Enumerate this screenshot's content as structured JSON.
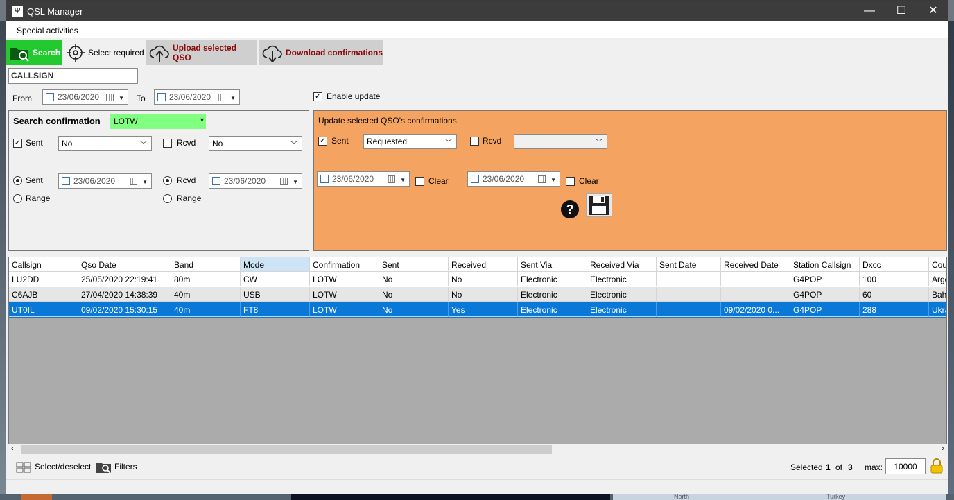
{
  "window": {
    "title": "QSL Manager",
    "minimize": "—",
    "maximize": "☐",
    "close": "✕"
  },
  "menu": {
    "special_activities": "Special activities"
  },
  "toolbar": {
    "search": "Search",
    "select_required": "Select required",
    "upload": "Upload selected QSO",
    "download": "Download confirmations"
  },
  "filters": {
    "callsign": "CALLSIGN",
    "from_label": "From",
    "from_date": "23/06/2020",
    "to_label": "To",
    "to_date": "23/06/2020",
    "enable_update_label": "Enable update",
    "enable_update_checked": true
  },
  "search_panel": {
    "title": "Search confirmation",
    "service": "LOTW",
    "sent_label": "Sent",
    "sent_value": "No",
    "rcvd_label": "Rcvd",
    "rcvd_value": "No",
    "radio_sent": "Sent",
    "radio_sent_date": "23/06/2020",
    "radio_range": "Range",
    "radio_rcvd": "Rcvd",
    "radio_rcvd_date": "23/06/2020",
    "radio_range2": "Range"
  },
  "update_panel": {
    "title": "Update selected QSO's confirmations",
    "sent_label": "Sent",
    "sent_value": "Requested",
    "rcvd_label": "Rcvd",
    "rcvd_value": "",
    "sent_date": "23/06/2020",
    "clear1": "Clear",
    "rcvd_date": "23/06/2020",
    "clear2": "Clear",
    "help": "?"
  },
  "grid": {
    "columns": [
      "Callsign",
      "Qso Date",
      "Band",
      "Mode",
      "Confirmation",
      "Sent",
      "Received",
      "Sent Via",
      "Received Via",
      "Sent Date",
      "Received Date",
      "Station Callsign",
      "Dxcc",
      "Cou"
    ],
    "rows": [
      [
        "LU2DD",
        "25/05/2020 22:19:41",
        "80m",
        "CW",
        "LOTW",
        "No",
        "No",
        "Electronic",
        "Electronic",
        "",
        "",
        "G4POP",
        "100",
        "Arge"
      ],
      [
        "C6AJB",
        "27/04/2020 14:38:39",
        "40m",
        "USB",
        "LOTW",
        "No",
        "No",
        "Electronic",
        "Electronic",
        "",
        "",
        "G4POP",
        "60",
        "Bah"
      ],
      [
        "UT0IL",
        "09/02/2020 15:30:15",
        "40m",
        "FT8",
        "LOTW",
        "No",
        "Yes",
        "Electronic",
        "Electronic",
        "",
        "09/02/2020 0...",
        "G4POP",
        "288",
        "Ukra"
      ]
    ],
    "selected_row": 2
  },
  "status": {
    "select_deselect": "Select/deselect",
    "filters": "Filters",
    "selected_label": "Selected",
    "selected_count": "1",
    "of_label": "of",
    "total": "3",
    "max_label": "max:",
    "max_value": "10000"
  },
  "desktop": {
    "north": "North",
    "turkey": "Turkey"
  },
  "colors": {
    "search_green": "#22c92f",
    "update_orange": "#f4a460",
    "selection_blue": "#0a78d7",
    "service_green": "#80ff80"
  }
}
